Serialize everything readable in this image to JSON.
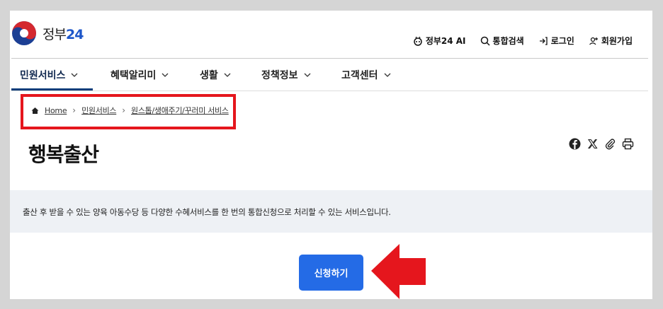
{
  "header": {
    "brand": "정부",
    "brand_number": "24",
    "utils": [
      {
        "label": "정부24 AI",
        "icon": "ai-icon"
      },
      {
        "label": "통합검색",
        "icon": "search-icon"
      },
      {
        "label": "로그인",
        "icon": "login-icon"
      },
      {
        "label": "회원가입",
        "icon": "user-plus-icon"
      }
    ]
  },
  "gnb": {
    "items": [
      {
        "label": "민원서비스"
      },
      {
        "label": "혜택알리미"
      },
      {
        "label": "생활"
      },
      {
        "label": "정책정보"
      },
      {
        "label": "고객센터"
      }
    ]
  },
  "breadcrumb": {
    "items": [
      "Home",
      "민원서비스",
      "원스톱/생애주기/꾸러미 서비스"
    ]
  },
  "page": {
    "title": "행복출산",
    "description": "출산 후 받을 수 있는 양육 아동수당 등 다양한 수혜서비스를 한 번의 통합신청으로 처리할 수 있는 서비스입니다.",
    "apply_label": "신청하기"
  },
  "colors": {
    "accent": "#246be6",
    "nav_underline": "#0b3d7a",
    "highlight": "#e5161d",
    "desc_bg": "#eef1f5"
  }
}
